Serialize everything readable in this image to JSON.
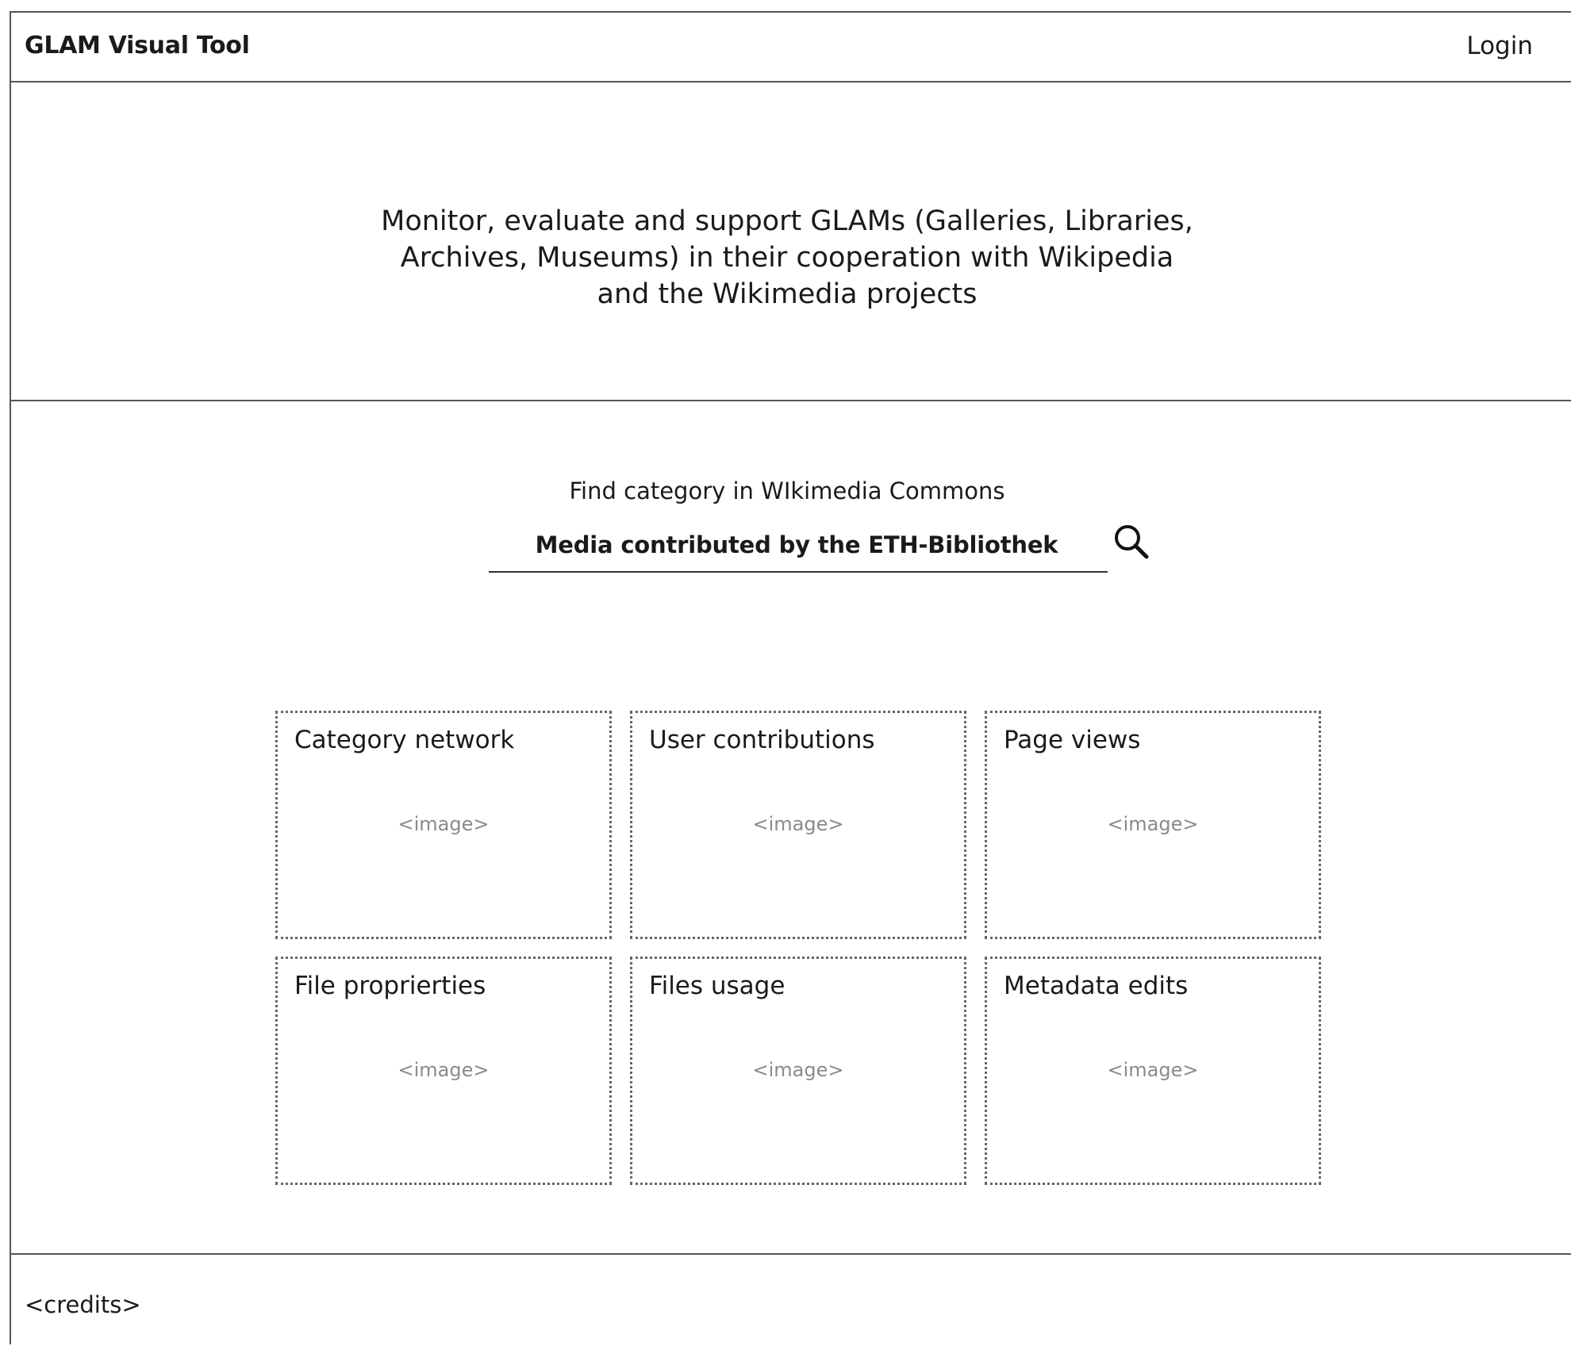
{
  "header": {
    "title": "GLAM Visual Tool",
    "login_label": "Login"
  },
  "hero": {
    "lines": [
      "Monitor, evaluate and support GLAMs (Galleries, Libraries,",
      "Archives, Museums) in their cooperation with Wikipedia",
      "and the Wikimedia projects"
    ]
  },
  "search": {
    "label": "Find category in WIkimedia Commons",
    "value": "Media contributed by the ETH-Bibliothek",
    "icon": "search-icon"
  },
  "cards": [
    {
      "title": "Category network",
      "image_placeholder": "<image>"
    },
    {
      "title": "User contributions",
      "image_placeholder": "<image>"
    },
    {
      "title": "Page views",
      "image_placeholder": "<image>"
    },
    {
      "title": "File proprierties",
      "image_placeholder": "<image>"
    },
    {
      "title": "Files usage",
      "image_placeholder": "<image>"
    },
    {
      "title": "Metadata edits",
      "image_placeholder": "<image>"
    }
  ],
  "footer": {
    "credits": "<credits>"
  }
}
